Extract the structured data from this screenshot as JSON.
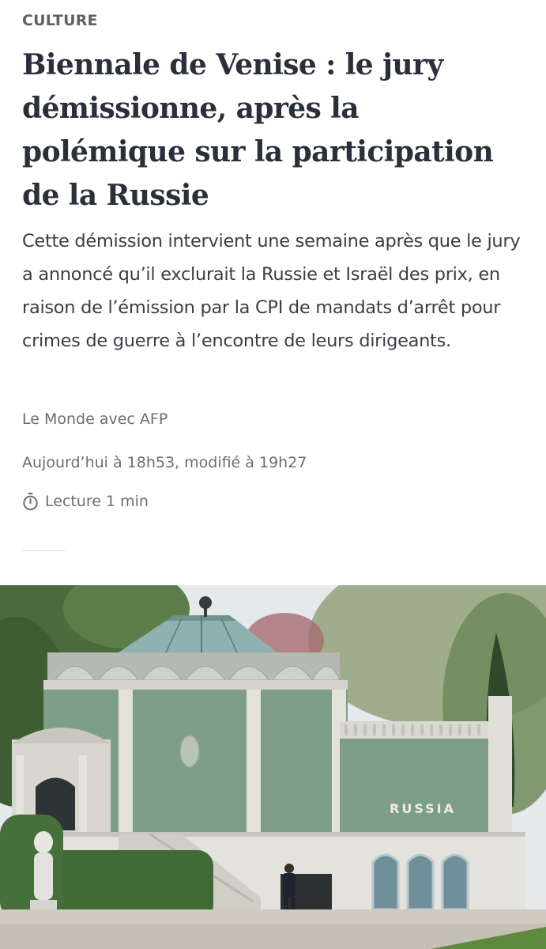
{
  "article": {
    "section": "CULTURE",
    "headline": "Biennale de Venise : le jury démissionne, après la polémique sur la participation de la Russie",
    "standfirst": "Cette démission intervient une semaine après que le jury a annoncé qu’il exclurait la Russie et Israël des prix, en raison de l’émission par la CPI de mandats d’arrêt pour crimes de guerre à l’encontre de leurs dirigeants.",
    "author": "Le Monde avec AFP",
    "date": "Aujourd’hui à 18h53, modifié à 19h27",
    "reading_time": "Lecture 1 min",
    "reading_icon": "stopwatch-icon"
  },
  "photo": {
    "pavilion_sign": "RUSSIA"
  },
  "colors": {
    "headline": "#2a303b",
    "meta": "#6b6e73",
    "pavilion_wall": "#7f9e87"
  }
}
